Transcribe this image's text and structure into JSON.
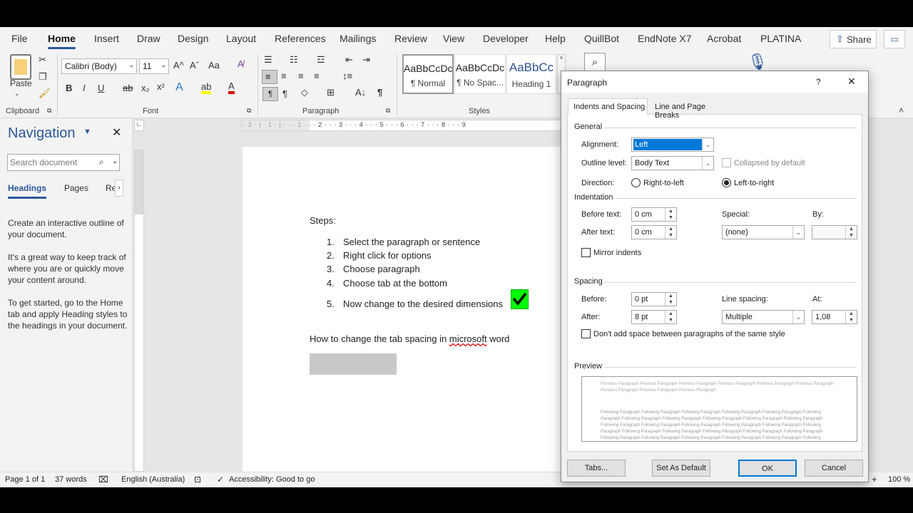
{
  "ribbon_tabs": [
    "File",
    "Home",
    "Insert",
    "Draw",
    "Design",
    "Layout",
    "References",
    "Mailings",
    "Review",
    "View",
    "Developer",
    "Help",
    "QuillBot",
    "EndNote X7",
    "Acrobat",
    "PLATINA"
  ],
  "share_label": "Share",
  "clipboard": {
    "paste": "Paste",
    "group": "Clipboard"
  },
  "font": {
    "name": "Calibri (Body)",
    "size": "11",
    "group": "Font",
    "bold": "B",
    "italic": "I",
    "underline": "U",
    "strike": "ab",
    "sub": "x₂",
    "sup": "x²",
    "grow": "A^",
    "shrink": "Aˇ",
    "case": "Aa",
    "effects": "A",
    "highlight": "ab",
    "color": "A"
  },
  "paragraph_group": "Paragraph",
  "styles": {
    "group": "Styles",
    "items": [
      {
        "preview": "AaBbCcDc",
        "name": "¶ Normal"
      },
      {
        "preview": "AaBbCcDc",
        "name": "¶ No Spac..."
      },
      {
        "preview": "AaBbCc",
        "name": "Heading 1"
      }
    ]
  },
  "nav": {
    "title": "Navigation",
    "search_placeholder": "Search document",
    "tabs": [
      "Headings",
      "Pages",
      "Re"
    ],
    "p1": "Create an interactive outline of your document.",
    "p2": "It's a great way to keep track of where you are or quickly move your content around.",
    "p3": "To get started, go to the Home tab and apply Heading styles to the headings in your document."
  },
  "doc": {
    "steps_title": "Steps:",
    "steps": [
      "Select the paragraph or sentence",
      "Right click for options",
      "Choose paragraph",
      "Choose tab at the bottom",
      "Now change to the desired dimensions"
    ],
    "numbers": [
      "1.",
      "2.",
      "3.",
      "4.",
      "5."
    ],
    "question_pre": "How to change the tab spacing in ",
    "question_word": "microsoft",
    "question_post": " word"
  },
  "hruler_text": "· 2 · | · 1 · | · · · 1 · · · 2 · · · 3 · · · 4 · · · 5 · · · 6 · · · 7 · · · 8 · · · 9",
  "status": {
    "page": "Page 1 of 1",
    "words": "37 words",
    "lang": "English (Australia)",
    "accessibility": "Accessibility: Good to go",
    "zoom": "100 %"
  },
  "dialog": {
    "title": "Paragraph",
    "help": "?",
    "close": "✕",
    "tabs": [
      "Indents and Spacing",
      "Line and Page Breaks"
    ],
    "general": "General",
    "alignment_label": "Alignment:",
    "alignment_value": "Left",
    "outline_label": "Outline level:",
    "outline_value": "Body Text",
    "collapsed_label": "Collapsed by default",
    "direction_label": "Direction:",
    "rtl": "Right-to-left",
    "ltr": "Left-to-right",
    "indentation": "Indentation",
    "before_text_label": "Before text:",
    "before_text_value": "0 cm",
    "after_text_label": "After text:",
    "after_text_value": "0 cm",
    "special_label": "Special:",
    "special_value": "(none)",
    "by_label": "By:",
    "by_value": "",
    "mirror_label": "Mirror indents",
    "spacing": "Spacing",
    "before_label": "Before:",
    "before_value": "0 pt",
    "after_label": "After:",
    "after_value": "8 pt",
    "line_spacing_label": "Line spacing:",
    "line_spacing_value": "Multiple",
    "at_label": "At:",
    "at_value": "1,08",
    "dont_add_label": "Don't add space between paragraphs of the same style",
    "preview": "Preview",
    "preview_prev": "Previous Paragraph Previous Paragraph Previous Paragraph Previous Paragraph Previous Paragraph Previous Paragraph Previous Paragraph Previous Paragraph Previous Paragraph",
    "preview_follow": "Following Paragraph Following Paragraph Following Paragraph Following Paragraph Following Paragraph Following Paragraph Following Paragraph Following Paragraph Following Paragraph Following Paragraph Following Paragraph Following Paragraph Following Paragraph Following Paragraph Following Paragraph Following Paragraph Following Paragraph Following Paragraph Following Paragraph Following Paragraph Following Paragraph Following Paragraph Following Paragraph Following Paragraph Following Paragraph Following Paragraph Following Paragraph Following Paragraph Following Paragraph Following Paragraph",
    "tabs_btn": "Tabs...",
    "default_btn": "Set As Default",
    "ok": "OK",
    "cancel": "Cancel"
  },
  "colors": {
    "accent": "#2b579a",
    "green": "#00ff00",
    "selection": "#0078d7"
  }
}
